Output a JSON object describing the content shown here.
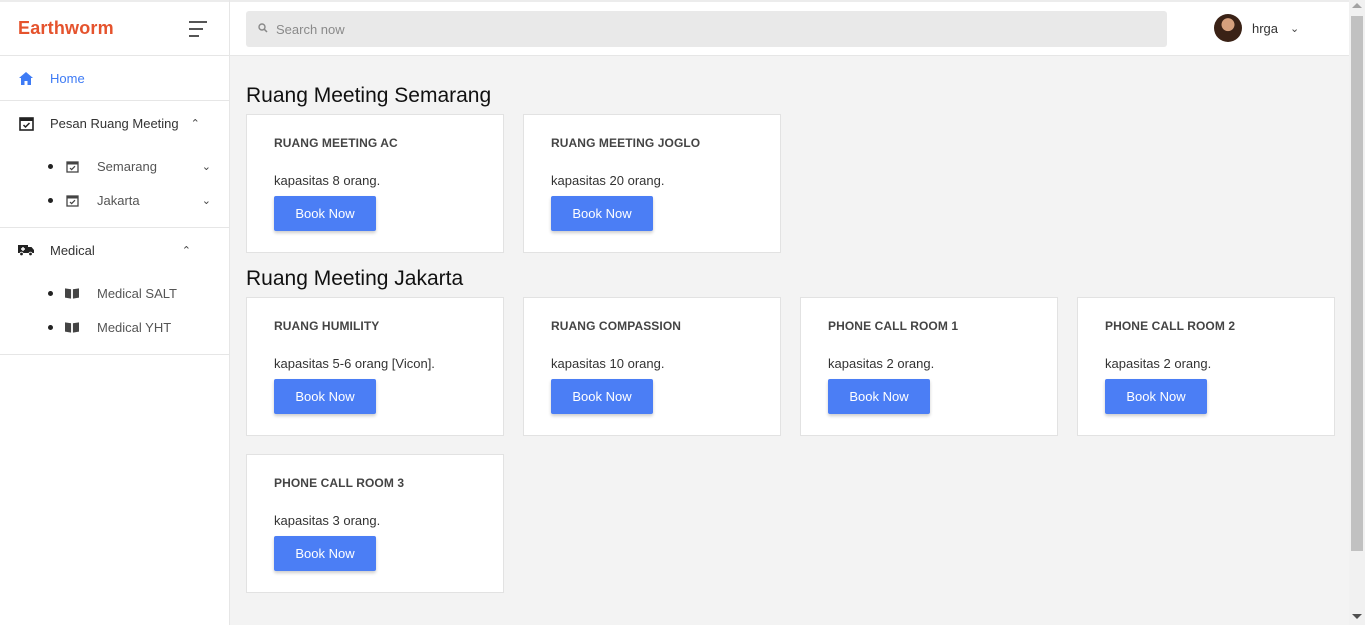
{
  "brand": {
    "logo_text": "Earthworm",
    "accent_color": "#e5532d"
  },
  "search": {
    "placeholder": "Search now"
  },
  "user": {
    "name": "hrga"
  },
  "sidebar": {
    "home_label": "Home",
    "meeting": {
      "label": "Pesan Ruang Meeting",
      "items": [
        {
          "label": "Semarang"
        },
        {
          "label": "Jakarta"
        }
      ]
    },
    "medical": {
      "label": "Medical",
      "items": [
        {
          "label": "Medical SALT"
        },
        {
          "label": "Medical YHT"
        }
      ]
    }
  },
  "sections": [
    {
      "title": "Ruang Meeting Semarang",
      "rooms": [
        {
          "name": "RUANG MEETING AC",
          "capacity": "kapasitas 8 orang.",
          "button": "Book Now"
        },
        {
          "name": "RUANG MEETING JOGLO",
          "capacity": "kapasitas 20 orang.",
          "button": "Book Now"
        }
      ]
    },
    {
      "title": "Ruang Meeting Jakarta",
      "rooms": [
        {
          "name": "RUANG HUMILITY",
          "capacity": "kapasitas 5-6 orang [Vicon].",
          "button": "Book Now"
        },
        {
          "name": "RUANG COMPASSION",
          "capacity": "kapasitas 10 orang.",
          "button": "Book Now"
        },
        {
          "name": "PHONE CALL ROOM 1",
          "capacity": "kapasitas 2 orang.",
          "button": "Book Now"
        },
        {
          "name": "PHONE CALL ROOM 2",
          "capacity": "kapasitas 2 orang.",
          "button": "Book Now"
        },
        {
          "name": "PHONE CALL ROOM 3",
          "capacity": "kapasitas 3 orang.",
          "button": "Book Now"
        }
      ]
    }
  ],
  "colors": {
    "primary": "#4b7ef5",
    "active_link": "#3e7bf5",
    "background": "#f3f3f3"
  }
}
